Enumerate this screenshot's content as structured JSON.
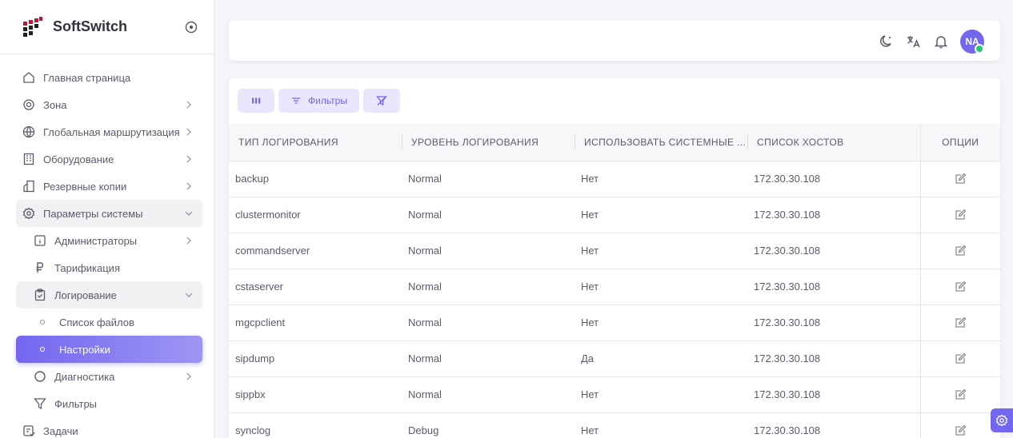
{
  "brand": {
    "name": "SoftSwitch"
  },
  "sidebar": {
    "items": [
      {
        "label": "Главная страница",
        "icon": "home-icon"
      },
      {
        "label": "Зона",
        "icon": "target-icon"
      },
      {
        "label": "Глобальная маршрутизация",
        "icon": "globe-icon"
      },
      {
        "label": "Оборудование",
        "icon": "building-icon"
      },
      {
        "label": "Резервные копии",
        "icon": "backup-icon"
      },
      {
        "label": "Параметры системы",
        "icon": "settings-icon"
      },
      {
        "label": "Администраторы",
        "icon": "admin-icon"
      },
      {
        "label": "Тарификация",
        "icon": "ruble-icon"
      },
      {
        "label": "Логирование",
        "icon": "clipboard-icon"
      },
      {
        "label": "Список файлов",
        "icon": "circle-dot-icon"
      },
      {
        "label": "Настройки",
        "icon": "circle-dot-icon"
      },
      {
        "label": "Диагностика",
        "icon": "circle-icon"
      },
      {
        "label": "Фильтры",
        "icon": "filter-icon"
      },
      {
        "label": "Задачи",
        "icon": "tasks-icon"
      }
    ]
  },
  "topbar": {
    "avatar_initials": "NA",
    "colors": {
      "accent": "#7367f0",
      "online": "#28c76f"
    }
  },
  "toolbar": {
    "filters_label": "Фильтры"
  },
  "table": {
    "columns": [
      "ТИП ЛОГИРОВАНИЯ",
      "УРОВЕНЬ ЛОГИРОВАНИЯ",
      "ИСПОЛЬЗОВАТЬ СИСТЕМНЫЕ ...",
      "СПИСОК ХОСТОВ",
      "ОПЦИИ"
    ],
    "rows": [
      [
        "backup",
        "Normal",
        "Нет",
        "172.30.30.108"
      ],
      [
        "clustermonitor",
        "Normal",
        "Нет",
        "172.30.30.108"
      ],
      [
        "commandserver",
        "Normal",
        "Нет",
        "172.30.30.108"
      ],
      [
        "cstaserver",
        "Normal",
        "Нет",
        "172.30.30.108"
      ],
      [
        "mgcpclient",
        "Normal",
        "Нет",
        "172.30.30.108"
      ],
      [
        "sipdump",
        "Normal",
        "Да",
        "172.30.30.108"
      ],
      [
        "sippbx",
        "Normal",
        "Нет",
        "172.30.30.108"
      ],
      [
        "synclog",
        "Debug",
        "Нет",
        "172.30.30.108"
      ]
    ]
  }
}
